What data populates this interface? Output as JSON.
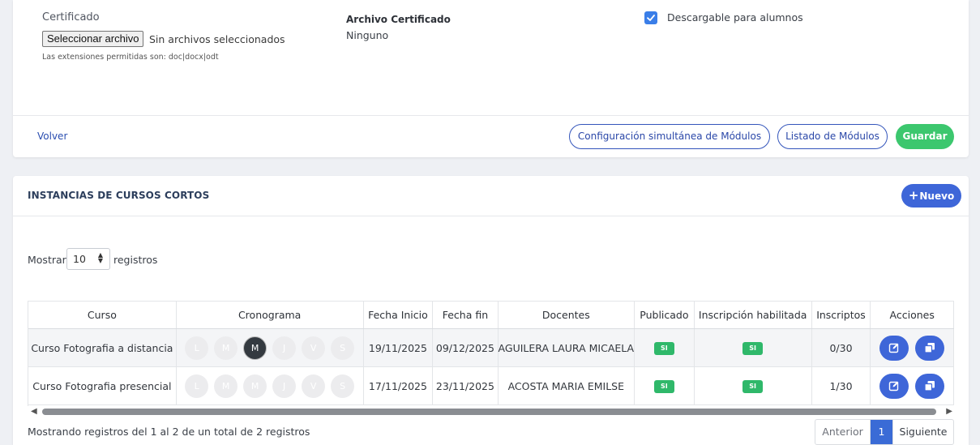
{
  "form": {
    "certificado_label": "Certificado",
    "file_button": "Seleccionar archivo",
    "file_status": "Sin archivos seleccionados",
    "extensions_note": "Las extensiones permitidas son: doc|docx|odt",
    "archivo_label": "Archivo Certificado",
    "archivo_value": "Ninguno",
    "descargable_label": "Descargable para alumnos",
    "descargable_checked": true
  },
  "actions": {
    "volver": "Volver",
    "config": "Configuración simultánea de Módulos",
    "listado": "Listado de Módulos",
    "guardar": "Guardar"
  },
  "section": {
    "title": "INSTANCIAS DE CURSOS CORTOS",
    "nuevo": "Nuevo"
  },
  "length_control": {
    "prefix": "Mostrar",
    "value": "10",
    "suffix": "registros"
  },
  "table": {
    "headers": [
      "Curso",
      "Cronograma",
      "Fecha Inicio",
      "Fecha fin",
      "Docentes",
      "Publicado",
      "Inscripción habilitada",
      "Inscriptos",
      "Acciones"
    ],
    "rows": [
      {
        "curso": "Curso Fotografia a distancia",
        "days": [
          "L",
          "M",
          "M",
          "J",
          "V",
          "S"
        ],
        "active_day_index": 2,
        "fecha_inicio": "19/11/2025",
        "fecha_fin": "09/12/2025",
        "docentes": "AGUILERA LAURA MICAELA",
        "publicado": "SI",
        "inscripcion": "SI",
        "inscriptos": "0/30"
      },
      {
        "curso": "Curso Fotografia presencial",
        "days": [
          "L",
          "M",
          "M",
          "J",
          "V",
          "S"
        ],
        "active_day_index": -1,
        "fecha_inicio": "17/11/2025",
        "fecha_fin": "23/11/2025",
        "docentes": "ACOSTA MARIA EMILSE",
        "publicado": "SI",
        "inscripcion": "SI",
        "inscriptos": "1/30"
      }
    ],
    "action_icons": [
      "edit-icon",
      "copy-icon"
    ]
  },
  "footer": {
    "info": "Mostrando registros del 1 al 2 de un total de 2 registros",
    "prev": "Anterior",
    "current_page": "1",
    "next": "Siguiente"
  },
  "colors": {
    "primary": "#3e66d8",
    "success": "#3cc76e",
    "checkbox": "#3a7ee8"
  }
}
